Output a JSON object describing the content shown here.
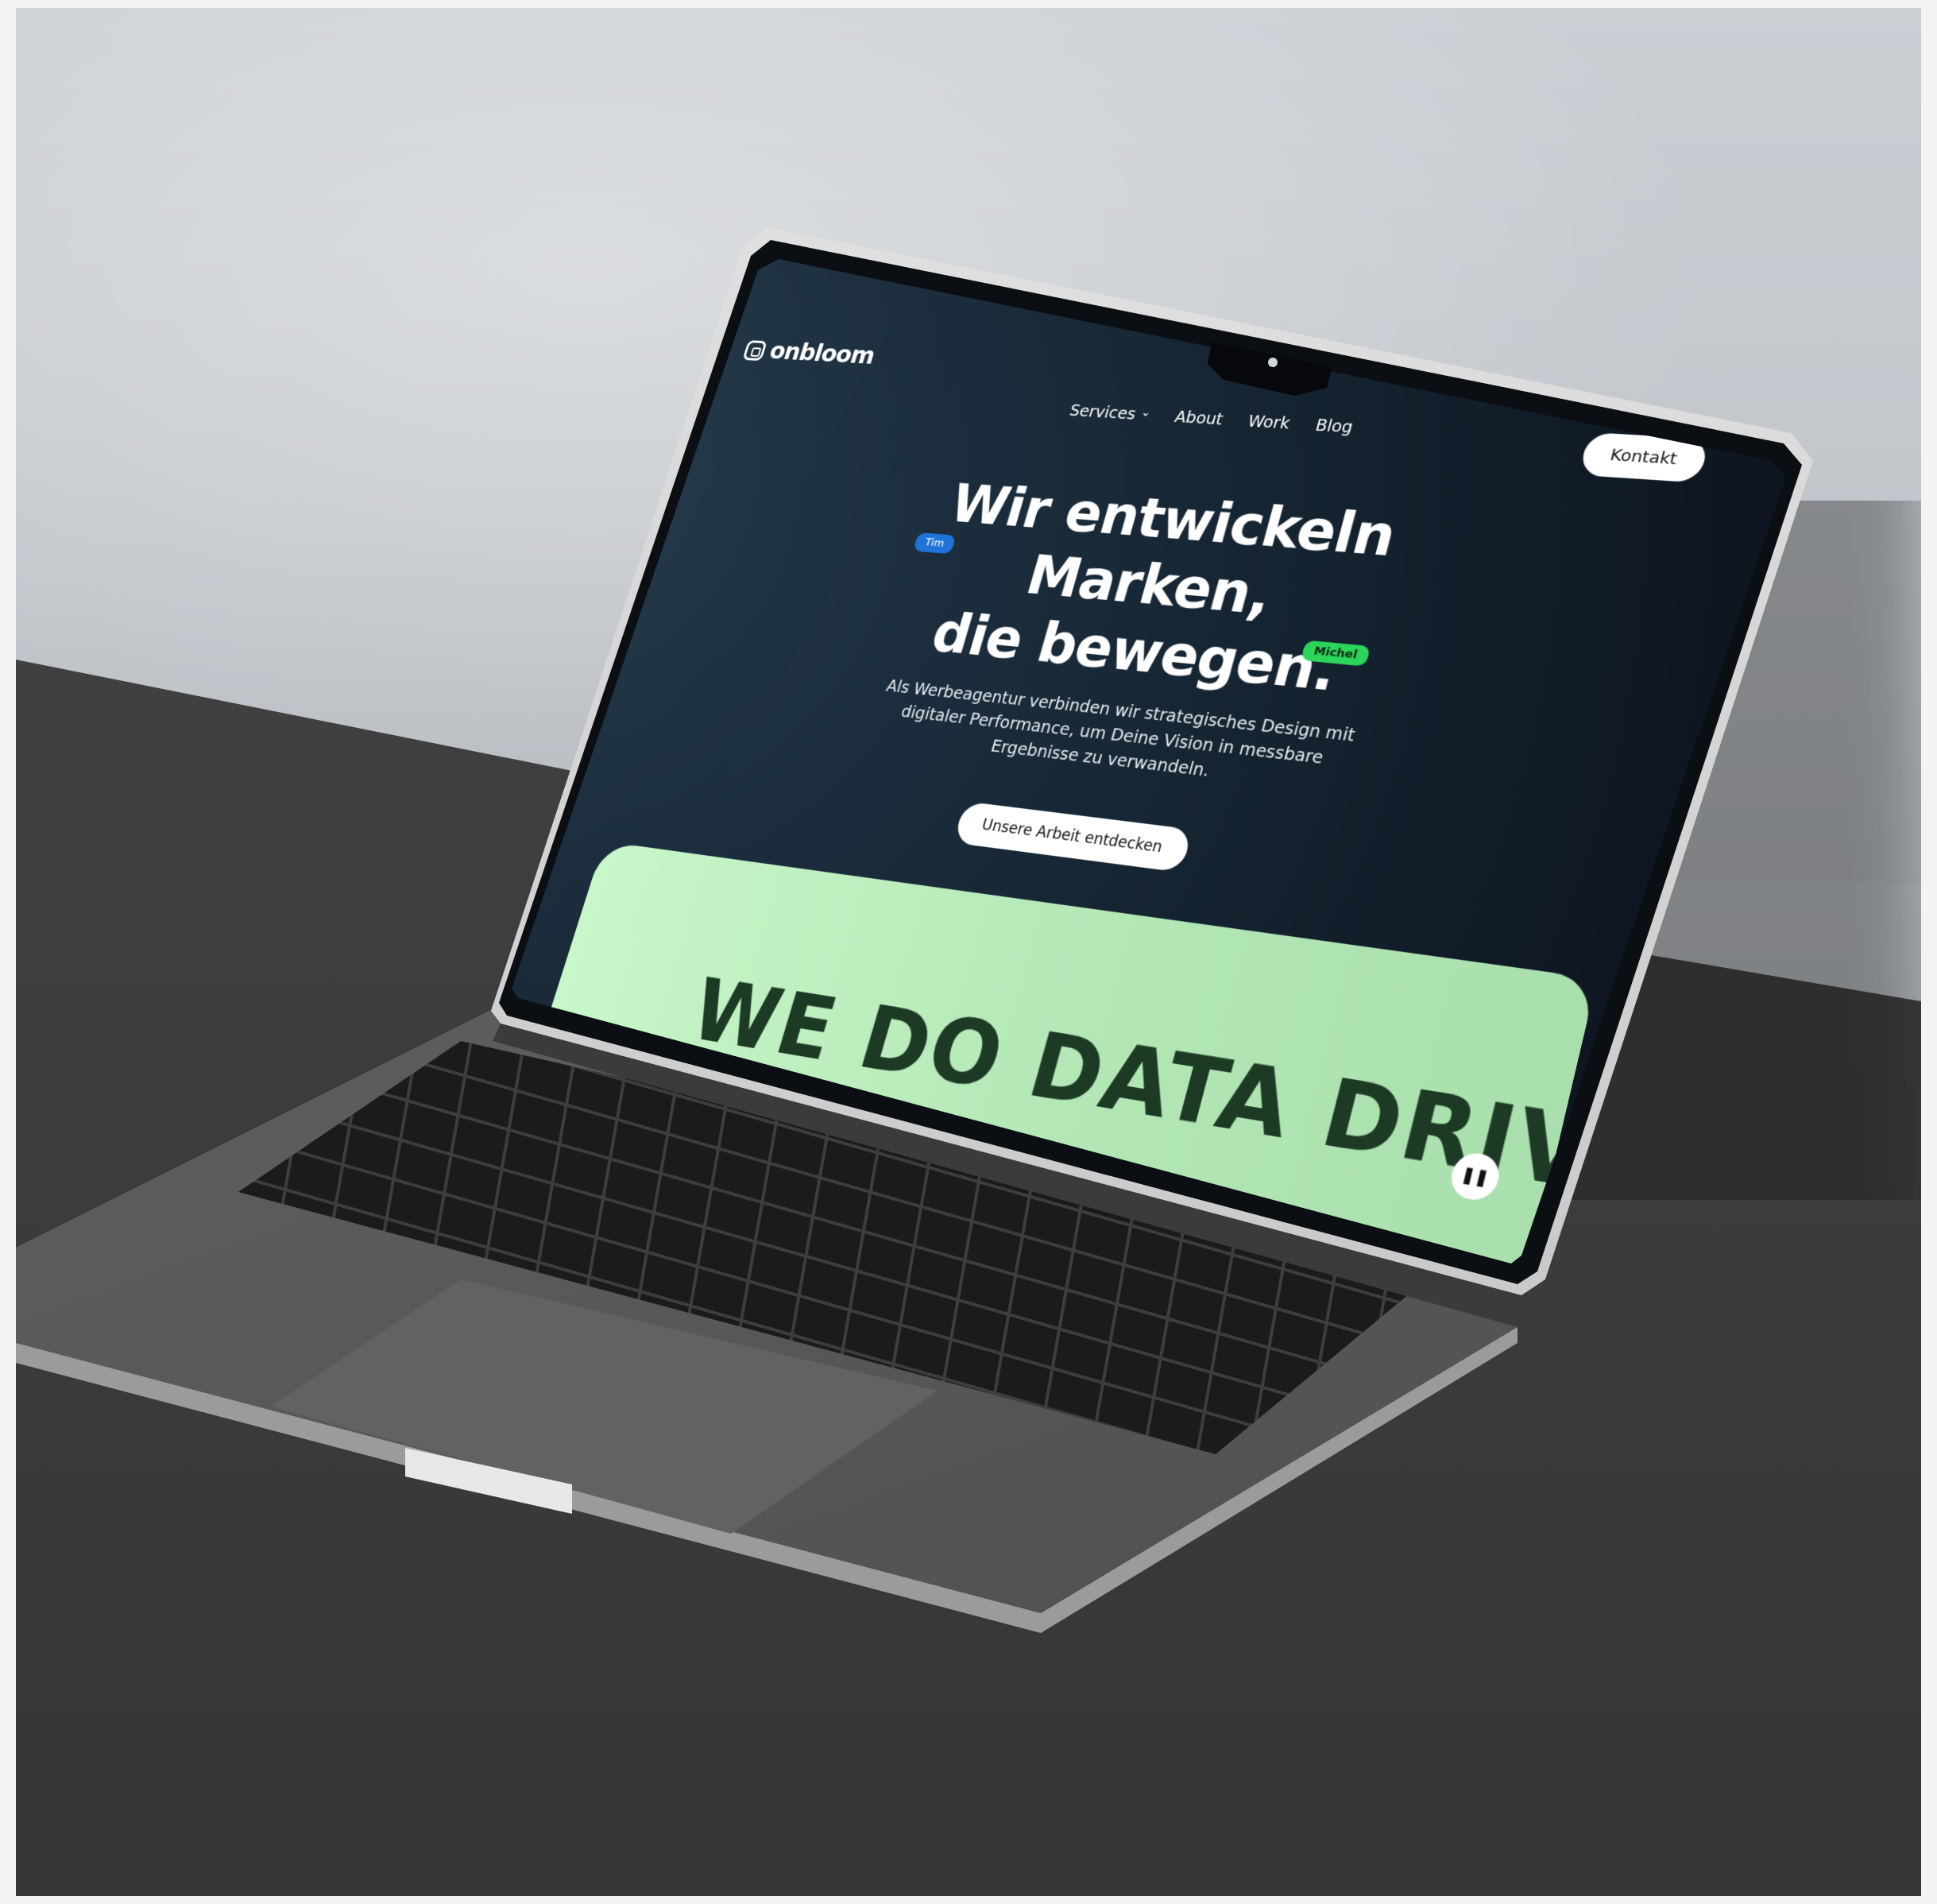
{
  "site": {
    "brand": "onbloom",
    "nav": {
      "services": "Services",
      "about": "About",
      "work": "Work",
      "blog": "Blog"
    },
    "contact_label": "Kontakt",
    "hero": {
      "title_line1": "Wir entwickeln Marken,",
      "title_line2": "die bewegen.",
      "subtitle": "Als Werbeagentur verbinden wir strategisches Design mit digitaler Performance, um Deine Vision in messbare Ergebnisse zu verwandeln.",
      "cta": "Unsere Arbeit entdecken"
    },
    "cursors": {
      "tim": "Tim",
      "michel": "Michel"
    },
    "banner": {
      "text": "WE DO DATA DRIVEN",
      "pause_icon": "pause-icon"
    }
  },
  "colors": {
    "screen_bg": "#0a0e17",
    "banner_green": "#b2e6b5",
    "tim_blue": "#1e74d8",
    "michel_green": "#2bd45a"
  }
}
